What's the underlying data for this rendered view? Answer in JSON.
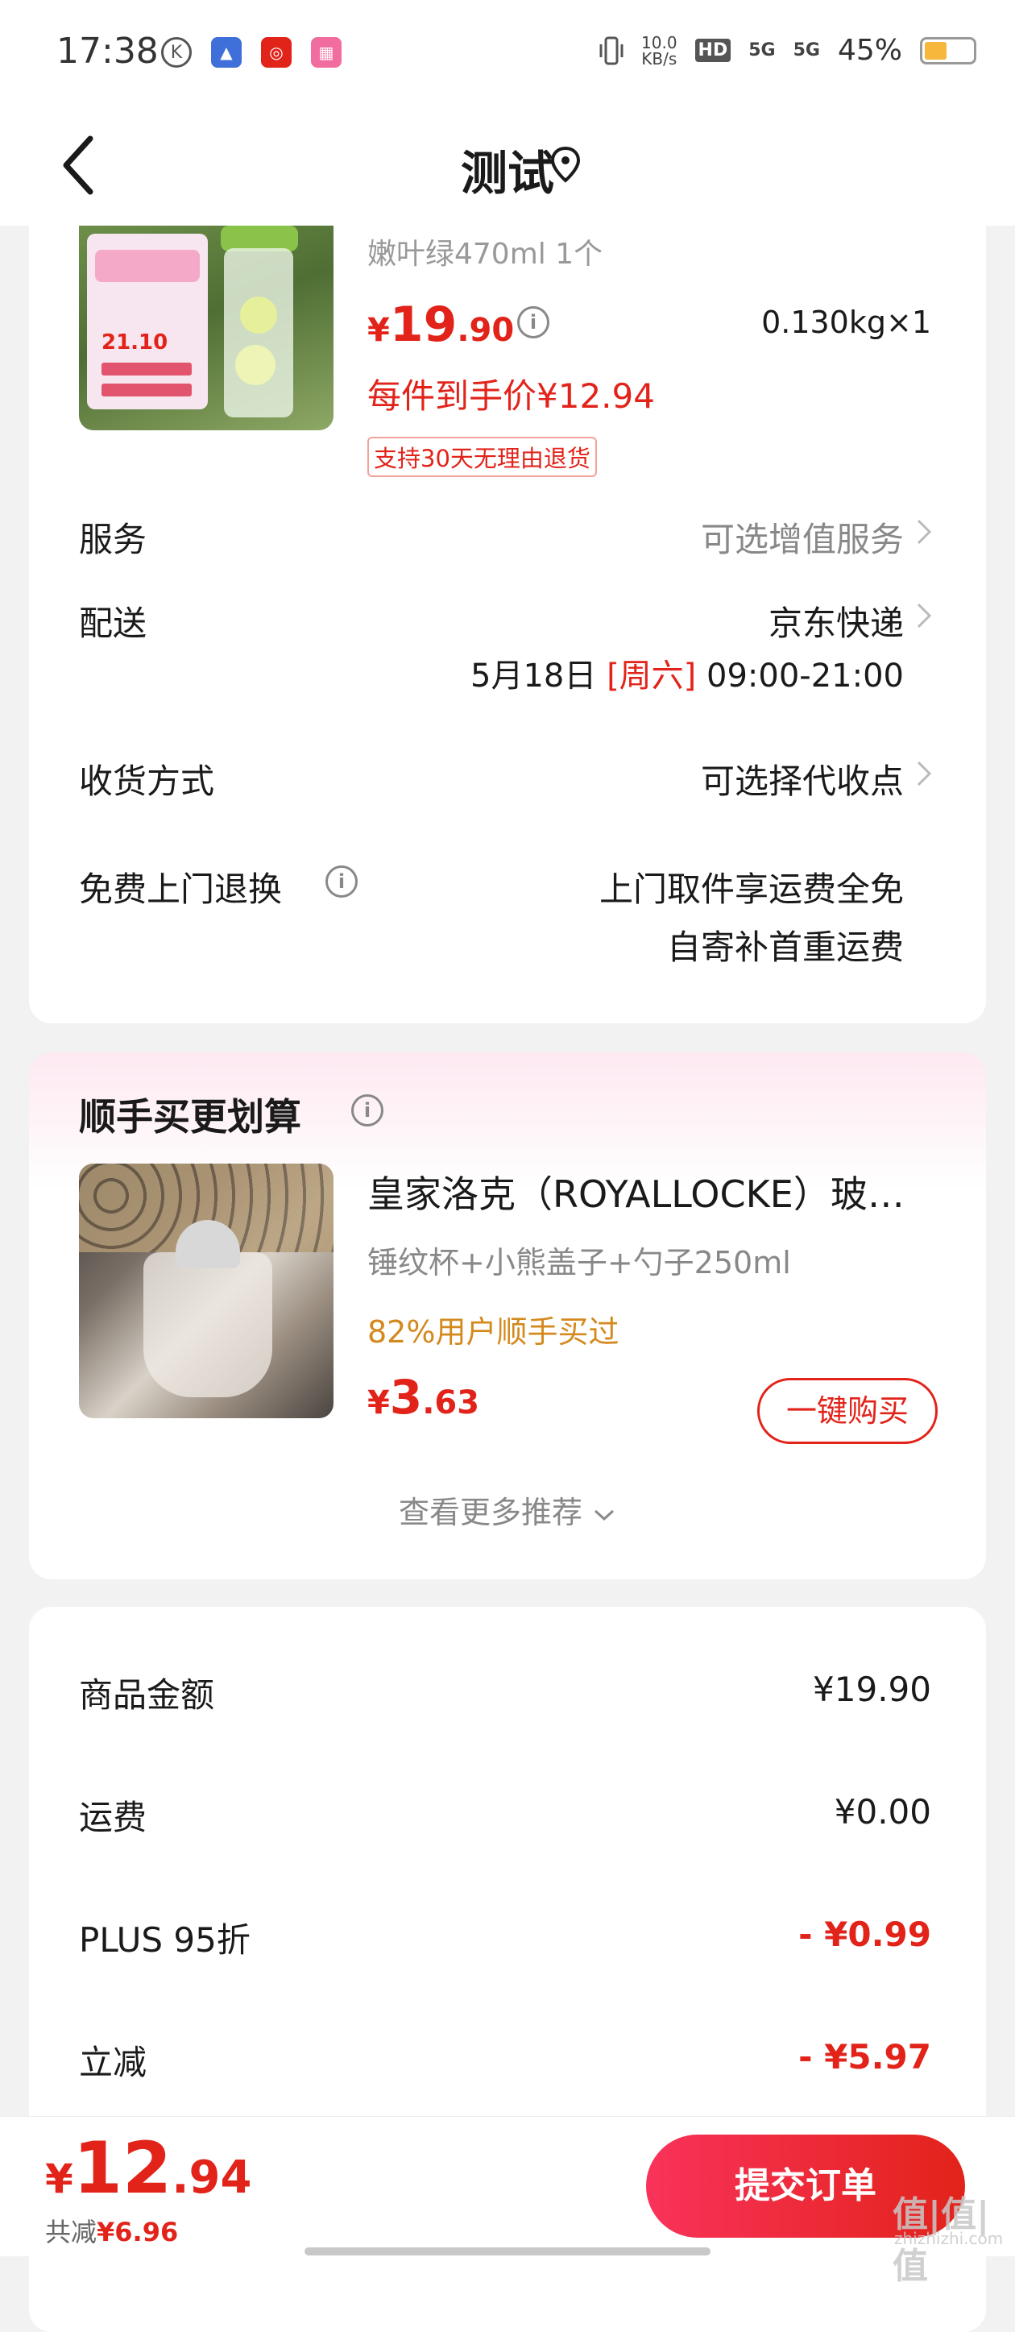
{
  "status_bar": {
    "time": "17:38",
    "net_speed": "10.0\nKB/s",
    "net_speed_top": "10.0",
    "net_speed_bottom": "KB/s",
    "hd": "HD",
    "sig1": "5G",
    "sig2": "5G",
    "battery": "45%"
  },
  "nav": {
    "title": "测试"
  },
  "product": {
    "spec": "嫩叶绿470ml 1个",
    "price_yen": "¥",
    "price_int": "19",
    "price_dec": ".90",
    "weight": "0.130kg×1",
    "final_price": "每件到手价¥12.94",
    "return_tag": "支持30天无理由退货",
    "img_badge": "21.10"
  },
  "rows": {
    "service_label": "服务",
    "service_value": "可选增值服务",
    "delivery_label": "配送",
    "delivery_value": "京东快递",
    "delivery_date": "5月18日",
    "delivery_weekday": "[周六]",
    "delivery_time": "09:00-21:00",
    "receive_label": "收货方式",
    "receive_value": "可选择代收点",
    "free_return_label": "免费上门退换",
    "free_return_line1": "上门取件享运费全免",
    "free_return_line2": "自寄补首重运费"
  },
  "recommend": {
    "title": "顺手买更划算",
    "product_title": "皇家洛克（ROYALLOCKE）玻璃杯",
    "product_spec": "锤纹杯+小熊盖子+勺子250ml",
    "buyers": "82%用户顺手买过",
    "price_yen": "¥",
    "price_int": "3",
    "price_dec": ".63",
    "buy_label": "一键购买",
    "more_label": "查看更多推荐"
  },
  "summary": {
    "items": [
      {
        "label": "商品金额",
        "value": "¥19.90"
      },
      {
        "label": "运费",
        "value": "¥0.00"
      },
      {
        "label": "PLUS 95折",
        "value": "- ¥0.99"
      },
      {
        "label": "立减",
        "value": "- ¥5.97"
      }
    ]
  },
  "bottom": {
    "total_yen": "¥",
    "total_int": "12",
    "total_dec": ".94",
    "saved_label": "共减",
    "saved_value": "¥6.96",
    "submit_label": "提交订单",
    "watermark": "值|值|值",
    "watermark_sub": "zhizhizhi.com"
  },
  "colors": {
    "accent_red": "#e2231a",
    "orange": "#d4891e",
    "gray": "#888888"
  }
}
